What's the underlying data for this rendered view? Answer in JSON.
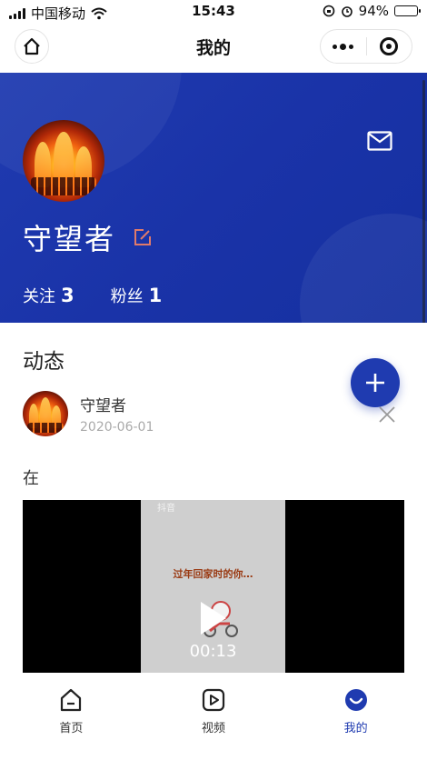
{
  "status_bar": {
    "carrier": "中国移动",
    "time": "15:43",
    "battery": "94%",
    "battery_level": 0.94
  },
  "navbar": {
    "title": "我的",
    "home_icon": "home-icon",
    "more_icon": "more-icon",
    "close_icon": "target-icon"
  },
  "profile": {
    "username": "守望者",
    "follow_label": "关注",
    "follow_count": "3",
    "fans_label": "粉丝",
    "fans_count": "1"
  },
  "feed": {
    "section_title": "动态",
    "post": {
      "author": "守望者",
      "date": "2020-06-01",
      "text": "在",
      "video": {
        "watermark": "抖音",
        "caption": "过年回家时的你…",
        "duration": "00:13"
      }
    }
  },
  "tabbar": {
    "items": [
      {
        "label": "首页",
        "icon": "home-icon"
      },
      {
        "label": "视频",
        "icon": "play-icon"
      },
      {
        "label": "我的",
        "icon": "smile-icon"
      }
    ]
  },
  "colors": {
    "accent": "#1f3bb0",
    "edit_icon": "#e07a6a"
  }
}
